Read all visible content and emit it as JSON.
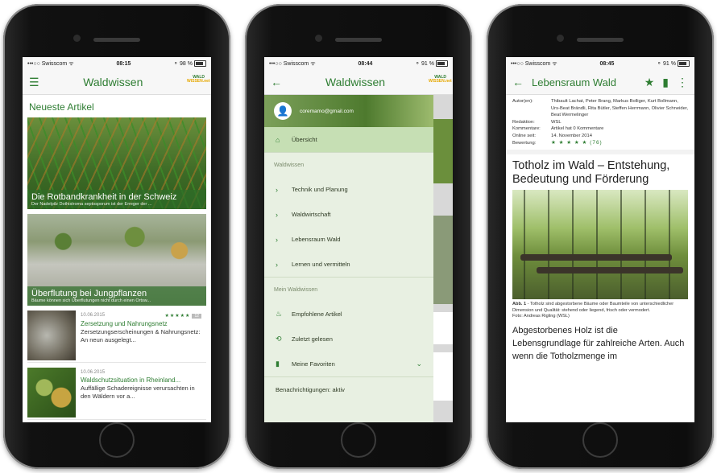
{
  "phone1": {
    "status": {
      "carrier": "•••○○ Swisscom ᯤ",
      "time": "08:15",
      "battery": "⚬ 98 %"
    },
    "title": "Waldwissen",
    "logo_top": "WALD",
    "logo_bottom": "WISSEN.net",
    "section_title": "Neueste Artikel",
    "hero1": {
      "title": "Die Rotbandkrankheit in der Schweiz",
      "subtitle": "Der Nadelpilz Dothistroma septosporum ist der Erreger der ..."
    },
    "hero2": {
      "title": "Überflutung bei Jungpflanzen",
      "subtitle": "Bäume können sich Überflutungen nicht durch einen Ortsw..."
    },
    "items": [
      {
        "date": "10.06.2015",
        "stars": "★★★★★",
        "badge": "12",
        "title": "Zersetzung und Nahrungsnetz",
        "text": "Zersetzungserscheinungen & Nahrungsnetz: An neun ausgelegt..."
      },
      {
        "date": "10.06.2015",
        "stars": "",
        "badge": "",
        "title": "Waldschutzsituation in Rheinland...",
        "text": "Auffällige Schadereignisse verursachten in den Wäldern vor a..."
      }
    ]
  },
  "phone2": {
    "status": {
      "carrier": "•••○○ Swisscom ᯤ",
      "time": "08:44",
      "battery": "⚬ 91 %"
    },
    "title": "Waldwissen",
    "logo_top": "WALD",
    "logo_bottom": "WISSEN.net",
    "email": "coremamo@gmail.com",
    "overview": "Übersicht",
    "section1": "Waldwissen",
    "nav": [
      "Technik und Planung",
      "Waldwirtschaft",
      "Lebensraum Wald",
      "Lernen und vermitteln"
    ],
    "section2": "Mein Waldwissen",
    "my": [
      {
        "label": "Empfohlene Artikel",
        "icon": "recommend-icon"
      },
      {
        "label": "Zuletzt gelesen",
        "icon": "history-icon"
      },
      {
        "label": "Meine Favoriten",
        "icon": "bookmark-icon"
      }
    ],
    "notifications": "Benachrichtigungen: aktiv"
  },
  "phone3": {
    "status": {
      "carrier": "•••○○ Swisscom ᯤ",
      "time": "08:45",
      "battery": "⚬ 91 %"
    },
    "title": "Lebensraum Wald",
    "meta": [
      {
        "k": "Autor(en):",
        "v": "Thibault Lachat, Peter Brang, Markus Bolliger, Kurt Bollmann, Urs-Beat Brändli, Rita Bütler, Steffen Herrmann, Olivier Schneider, Beat Wermelinger"
      },
      {
        "k": "Redaktion:",
        "v": "WSL"
      },
      {
        "k": "Kommentare:",
        "v": "Artikel hat 0 Kommentare"
      },
      {
        "k": "Online seit:",
        "v": "14. November 2014"
      },
      {
        "k": "Bewertung:",
        "v": "★ ★ ★ ★ ★  (76)"
      }
    ],
    "article_title": "Totholz im Wald – Entstehung, Bedeutung und Förderung",
    "caption_bold": "Abb. 1",
    "caption": " - Totholz sind abgestorbene Bäume oder Baumteile von unterschiedlicher Dimension und Qualität: stehend oder liegend, frisch oder vermodert.",
    "photo_credit": "Foto: Andreas Rigling (WSL)",
    "body": "Abgestorbenes Holz ist die Lebensgrundlage für zahlreiche Arten. Auch wenn die Totholzmenge im"
  }
}
